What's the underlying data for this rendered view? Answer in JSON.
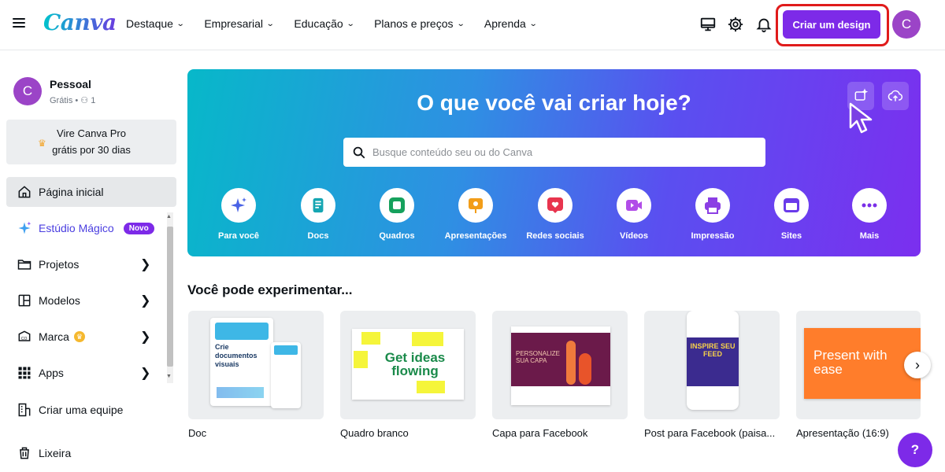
{
  "brand": {
    "logo_text": "Canva",
    "accent": "#7d2ae8",
    "highlight": "#e01b1b"
  },
  "nav": {
    "items": [
      {
        "label": "Destaque"
      },
      {
        "label": "Empresarial"
      },
      {
        "label": "Educação"
      },
      {
        "label": "Planos e preços"
      },
      {
        "label": "Aprenda"
      }
    ],
    "icons": [
      "monitor-icon",
      "gear-icon",
      "bell-icon"
    ],
    "create_label": "Criar um design",
    "avatar_letter": "C"
  },
  "sidebar": {
    "account": {
      "avatar_letter": "C",
      "name": "Pessoal",
      "meta": "Grátis • ⚇ 1"
    },
    "promo": {
      "line1": "Vire Canva Pro",
      "line2": "grátis por 30 dias"
    },
    "items": [
      {
        "label": "Página inicial",
        "icon": "home-icon",
        "active": true
      },
      {
        "label": "Estúdio Mágico",
        "icon": "sparkle-icon",
        "badge": "Novo"
      },
      {
        "label": "Projetos",
        "icon": "folder-icon"
      },
      {
        "label": "Modelos",
        "icon": "template-icon"
      },
      {
        "label": "Marca",
        "icon": "brand-icon"
      },
      {
        "label": "Apps",
        "icon": "apps-icon"
      },
      {
        "label": "Criar uma equipe",
        "icon": "team-icon"
      },
      {
        "label": "Lixeira",
        "icon": "trash-icon"
      }
    ]
  },
  "hero": {
    "title": "O que você vai criar hoje?",
    "search_placeholder": "Busque conteúdo seu ou do Canva",
    "categories": [
      {
        "label": "Para você",
        "icon": "sparkle-icon",
        "color": "#4a63e6"
      },
      {
        "label": "Docs",
        "icon": "doc-icon",
        "color": "#15a6b2"
      },
      {
        "label": "Quadros",
        "icon": "whiteboard-icon",
        "color": "#16a15d"
      },
      {
        "label": "Apresentações",
        "icon": "presentation-icon",
        "color": "#f29d18"
      },
      {
        "label": "Redes sociais",
        "icon": "heart-icon",
        "color": "#e8344e"
      },
      {
        "label": "Vídeos",
        "icon": "video-icon",
        "color": "#b14de8"
      },
      {
        "label": "Impressão",
        "icon": "print-icon",
        "color": "#8b3ee4"
      },
      {
        "label": "Sites",
        "icon": "website-icon",
        "color": "#6a3bea"
      },
      {
        "label": "Mais",
        "icon": "more-icon",
        "color": "#7a2fe8"
      }
    ]
  },
  "suggestions": {
    "title": "Você pode experimentar...",
    "cards": [
      {
        "label": "Doc",
        "thumb_text": "Crie documentos visuais"
      },
      {
        "label": "Quadro branco",
        "thumb_text": "Get ideas flowing"
      },
      {
        "label": "Capa para Facebook",
        "thumb_text": "PERSONALIZE SUA CAPA"
      },
      {
        "label": "Post para Facebook (paisa...",
        "thumb_text": "INSPIRE SEU FEED"
      },
      {
        "label": "Apresentação (16:9)",
        "thumb_text": "Present with ease"
      }
    ]
  },
  "help_label": "?"
}
